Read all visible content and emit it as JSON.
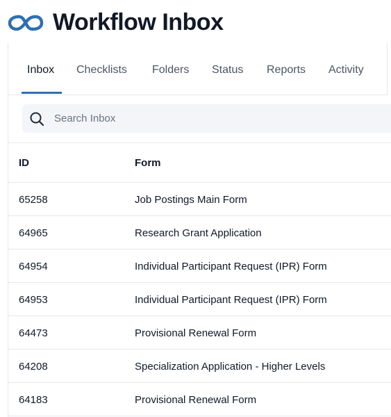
{
  "header": {
    "title": "Workflow Inbox",
    "logo_icon": "link-loop-icon",
    "accent_color": "#2f6fb1"
  },
  "tabs": [
    {
      "label": "Inbox",
      "active": true
    },
    {
      "label": "Checklists",
      "active": false
    },
    {
      "label": "Folders",
      "active": false
    },
    {
      "label": "Status",
      "active": false
    },
    {
      "label": "Reports",
      "active": false
    },
    {
      "label": "Activity",
      "active": false
    }
  ],
  "search": {
    "placeholder": "Search Inbox",
    "value": "",
    "icon": "search-icon"
  },
  "table": {
    "columns": [
      "ID",
      "Form"
    ],
    "rows": [
      {
        "id": "65258",
        "form": "Job Postings Main Form"
      },
      {
        "id": "64965",
        "form": "Research Grant Application"
      },
      {
        "id": "64954",
        "form": "Individual Participant Request (IPR) Form"
      },
      {
        "id": "64953",
        "form": "Individual Participant Request (IPR) Form"
      },
      {
        "id": "64473",
        "form": "Provisional Renewal Form"
      },
      {
        "id": "64208",
        "form": "Specialization Application - Higher Levels"
      },
      {
        "id": "64183",
        "form": "Provisional Renewal Form"
      }
    ]
  }
}
